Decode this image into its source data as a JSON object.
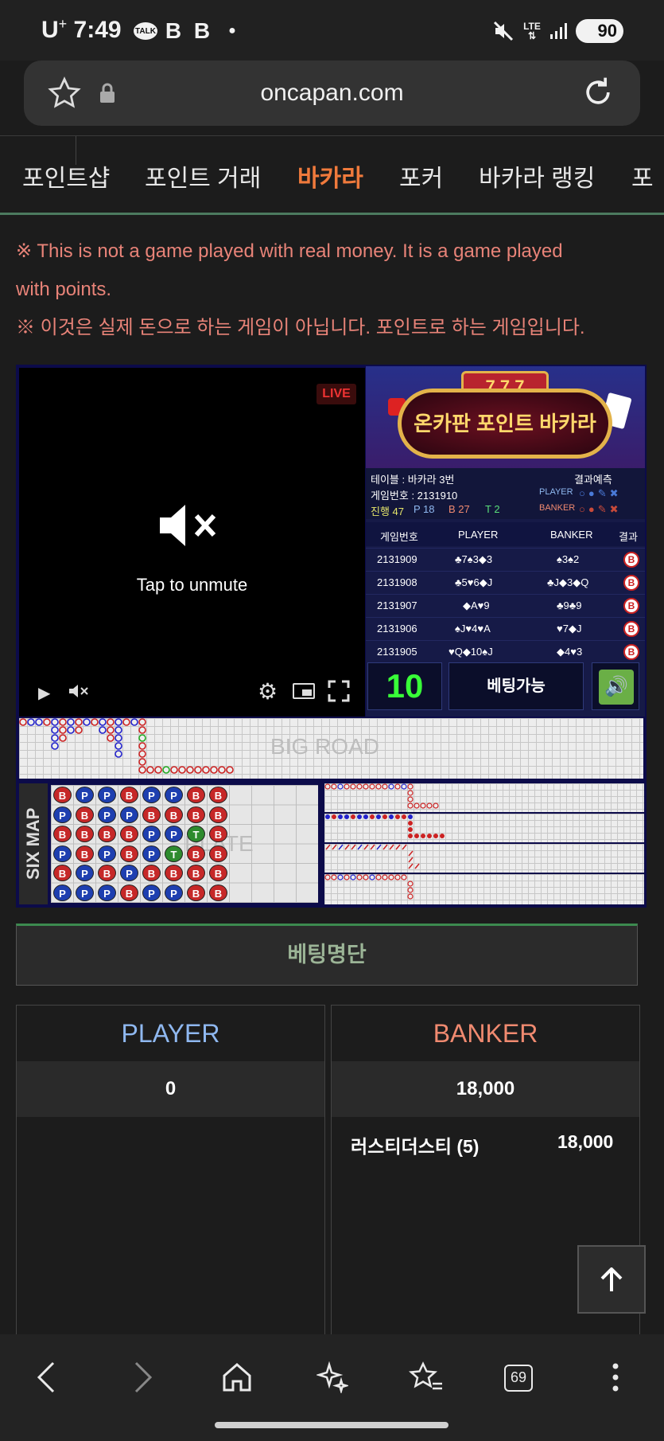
{
  "status_bar": {
    "carrier": "U",
    "carrier_sup": "+",
    "time": "7:49",
    "talk": "TALK",
    "net": "LTE",
    "battery": "90"
  },
  "browser": {
    "url": "oncapan.com",
    "tabs_count": "69"
  },
  "nav": {
    "items": [
      "포인트샵",
      "포인트 거래",
      "바카라",
      "포커",
      "바카라 랭킹",
      "포"
    ],
    "active_index": 2
  },
  "notice": {
    "en_line1": "※ This is not a game played with real money. It is a game played",
    "en_line2": "with points.",
    "ko": "※ 이것은 실제 돈으로 하는 게임이 아닙니다. 포인트로 하는 게임입니다."
  },
  "video": {
    "live_badge": "LIVE",
    "unmute_text": "Tap to unmute"
  },
  "game_panel": {
    "banner_title": "온카판 포인트 바카라",
    "table_label": "테이블 : 바카라 3번",
    "prediction_label": "결과예측",
    "game_no_label": "게임번호 : 2131910",
    "progress_label": "진행 47",
    "p_count": "P 18",
    "b_count": "B 27",
    "t_count": "T 2",
    "player_label": "PLAYER",
    "banker_label": "BANKER",
    "columns": [
      "게임번호",
      "PLAYER",
      "BANKER",
      "결과"
    ],
    "rows": [
      {
        "id": "2131909",
        "player": "♣7♠3◆3",
        "banker": "♠3♠2",
        "result": "B"
      },
      {
        "id": "2131908",
        "player": "♣5♥6◆J",
        "banker": "♣J◆3◆Q",
        "result": "B"
      },
      {
        "id": "2131907",
        "player": "◆A♥9",
        "banker": "♣9♣9",
        "result": "B"
      },
      {
        "id": "2131906",
        "player": "♠J♥4♥A",
        "banker": "♥7◆J",
        "result": "B"
      },
      {
        "id": "2131905",
        "player": "♥Q◆10♠J",
        "banker": "◆4♥3",
        "result": "B"
      }
    ],
    "timer": "10",
    "bet_status": "베팅가능"
  },
  "roads": {
    "big_road_label": "BIG ROAD",
    "six_map_label": "SIX MAP",
    "plate_label": "PLATE",
    "plate_columns": [
      [
        "B",
        "P",
        "B",
        "P",
        "B",
        "P"
      ],
      [
        "P",
        "B",
        "B",
        "B",
        "P",
        "P"
      ],
      [
        "P",
        "P",
        "B",
        "P",
        "B",
        "P"
      ],
      [
        "B",
        "P",
        "B",
        "B",
        "P",
        "B"
      ],
      [
        "P",
        "B",
        "P",
        "P",
        "B",
        "P"
      ],
      [
        "P",
        "B",
        "P",
        "T",
        "B",
        "P"
      ],
      [
        "B",
        "B",
        "T",
        "B",
        "B",
        "B"
      ],
      [
        "B",
        "B",
        "B",
        "B",
        "B",
        "B"
      ]
    ]
  },
  "betting": {
    "list_button": "베팅명단",
    "player_header": "PLAYER",
    "banker_header": "BANKER",
    "player_total": "0",
    "banker_total": "18,000",
    "banker_bets": [
      {
        "name": "러스티더스티 (5)",
        "amount": "18,000"
      }
    ]
  },
  "colors": {
    "accent": "#f07a3c",
    "player": "#8fb8f0",
    "banker": "#f08a70",
    "notice": "#e88378",
    "timer": "#38ff38"
  }
}
